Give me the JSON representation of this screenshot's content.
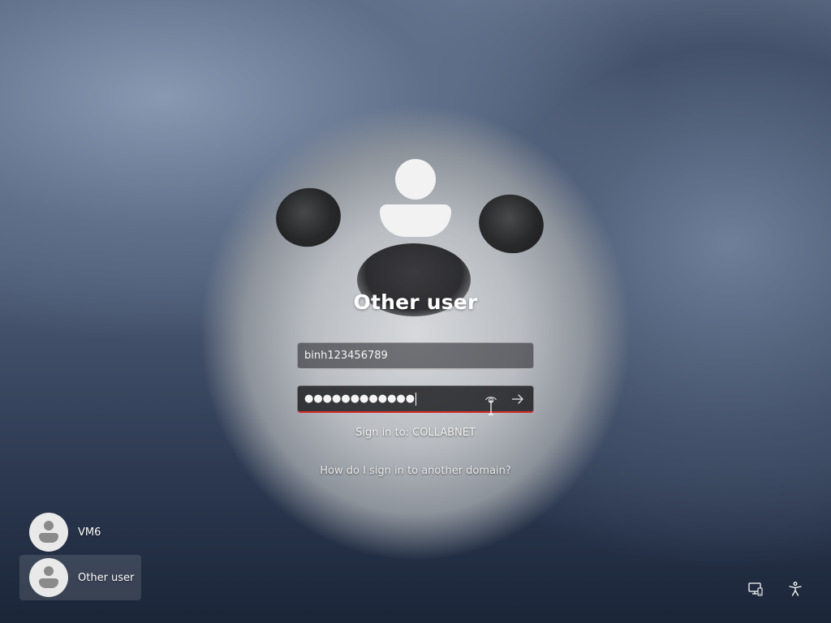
{
  "login": {
    "title": "Other user",
    "username_value": "binh123456789",
    "password_mask": "●●●●●●●●●●●●",
    "signin_target": "Sign in to: COLLABNET",
    "domain_help_link": "How do I sign in to another domain?",
    "error_color": "#d8302b"
  },
  "users": [
    {
      "name": "VM6",
      "selected": false
    },
    {
      "name": "Other user",
      "selected": true
    }
  ],
  "icons": {
    "avatar": "person-icon",
    "reveal": "eye-reveal-icon",
    "submit": "arrow-right-icon",
    "network": "network-icon",
    "accessibility": "accessibility-icon"
  }
}
